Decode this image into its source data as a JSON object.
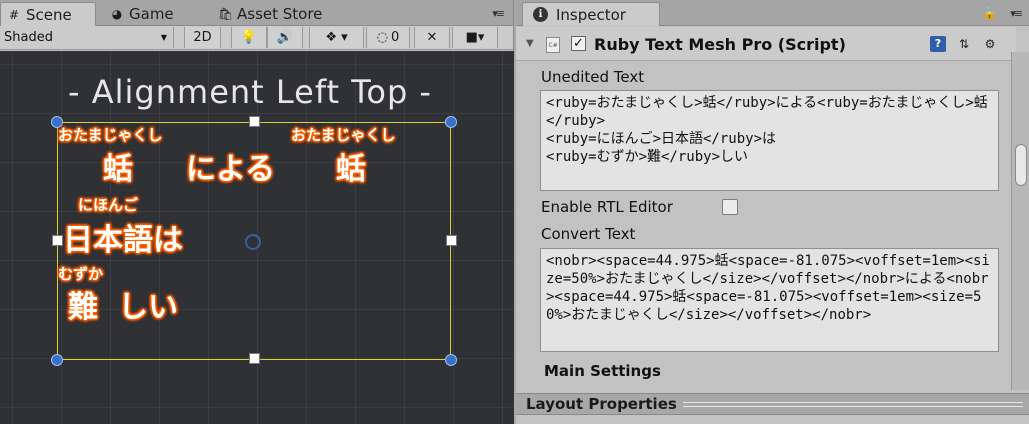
{
  "scene_panel": {
    "tabs": [
      {
        "label": "Scene",
        "icon": "grid-icon"
      },
      {
        "label": "Game",
        "icon": "pacman-icon"
      },
      {
        "label": "Asset Store",
        "icon": "store-icon"
      }
    ],
    "toolbar": {
      "shading_mode": "Shaded",
      "mode_2d": "2D",
      "hidden_count": "0"
    },
    "scene_title": "- Alignment Left Top -",
    "text_lines": [
      {
        "ruby": [
          "おたまじゃくし",
          "おたまじゃくし"
        ],
        "base": [
          "蛞",
          "による",
          "蛞"
        ]
      },
      {
        "ruby": [
          "にほんご"
        ],
        "base": [
          "日本語は"
        ]
      },
      {
        "ruby": [
          "むずか"
        ],
        "base": [
          "難",
          "しい"
        ]
      }
    ],
    "colors": {
      "glow": "#ff6a00",
      "grid_bg": "#2f3135",
      "selection": "#d8d235"
    }
  },
  "inspector": {
    "tab_label": "Inspector",
    "component_title": "Ruby Text Mesh Pro (Script)",
    "component_enabled": true,
    "unedited_text_label": "Unedited Text",
    "unedited_text_value": "<ruby=おたまじゃくし>蛞</ruby>による<ruby=おたまじゃくし>蛞</ruby>\n<ruby=にほんご>日本語</ruby>は\n<ruby=むずか>難</ruby>しい",
    "enable_rtl_label": "Enable RTL Editor",
    "enable_rtl_value": false,
    "convert_text_label": "Convert Text",
    "convert_text_value": "<nobr><space=44.975>蛞<space=-81.075><voffset=1em><size=50%>おたまじゃくし</size></voffset></nobr>による<nobr><space=44.975>蛞<space=-81.075><voffset=1em><size=50%>おたまじゃくし</size></voffset></nobr>",
    "main_settings_label": "Main Settings",
    "layout_properties_label": "Layout Properties"
  }
}
